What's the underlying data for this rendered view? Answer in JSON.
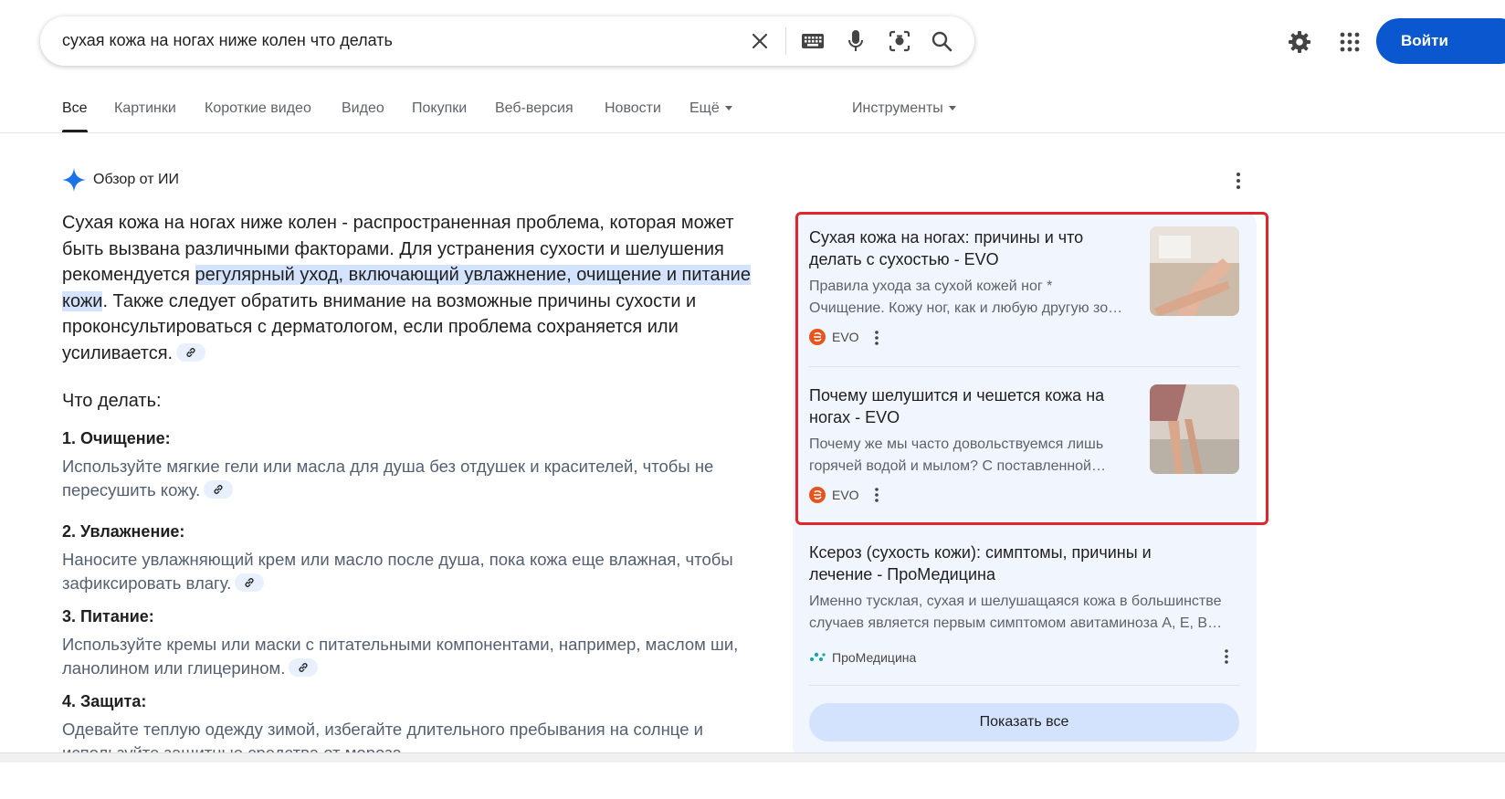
{
  "search": {
    "query": "сухая кожа на ногах ниже колен что делать"
  },
  "header": {
    "signin_label": "Войти"
  },
  "tabs": [
    {
      "label": "Все"
    },
    {
      "label": "Картинки"
    },
    {
      "label": "Короткие видео"
    },
    {
      "label": "Видео"
    },
    {
      "label": "Покупки"
    },
    {
      "label": "Веб-версия"
    },
    {
      "label": "Новости"
    },
    {
      "label": "Ещё"
    },
    {
      "label": "Инструменты"
    }
  ],
  "ai": {
    "heading": "Обзор от ИИ",
    "lead_pre": "Сухая кожа на ногах ниже колен - распространенная проблема, которая может быть вызвана различными факторами. Для устранения сухости и шелушения рекомендуется ",
    "lead_hl": "регулярный уход, включающий увлажнение, очищение и питание кожи",
    "lead_post": ". Также следует обратить внимание на возможные причины сухости и проконсультироваться с дерматологом, если проблема сохраняется или усиливается.",
    "what_title": "Что делать:",
    "steps": [
      {
        "title": "1. Очищение:",
        "text": "Используйте мягкие гели или масла для душа без отдушек и красителей, чтобы не пересушить кожу."
      },
      {
        "title": "2. Увлажнение:",
        "text": "Наносите увлажняющий крем или масло после душа, пока кожа еще влажная, чтобы зафиксировать влагу."
      },
      {
        "title": "3. Питание:",
        "text": "Используйте кремы или маски с питательными компонентами, например, маслом ши, ланолином или глицерином."
      },
      {
        "title": "4. Защита:",
        "text": "Одевайте теплую одежду зимой, избегайте длительного пребывания на солнце и используйте защитные средства от мороза."
      }
    ]
  },
  "sources": [
    {
      "title": "Сухая кожа на ногах: причины и что делать с сухостью - EVO",
      "snippet1": "Правила ухода за сухой кожей ног *",
      "snippet2": "Очищение. Кожу ног, как и любую другую зо…",
      "site": "EVO"
    },
    {
      "title": "Почему шелушится и чешется кожа на ногах - EVO",
      "snippet1": "Почему же мы часто довольствуемся лишь",
      "snippet2": "горячей водой и мылом? С поставленной…",
      "site": "EVO"
    },
    {
      "title": "Ксероз (сухость кожи): симптомы, причины и лечение - ПроМедицина",
      "snippet1": "Именно тусклая, сухая и шелушащаяся кожа в большинстве",
      "snippet2": "случаев является первым симптомом авитаминоза А, Е, В…",
      "site": "ПроМедицина"
    }
  ],
  "show_all_label": "Показать все",
  "colors": {
    "accent": "#0b57d0",
    "highlight": "#d3e3fd",
    "annotation_box": "#e0262c",
    "evo_logo": "#e8541e",
    "promed_logo": "#13a89e"
  }
}
